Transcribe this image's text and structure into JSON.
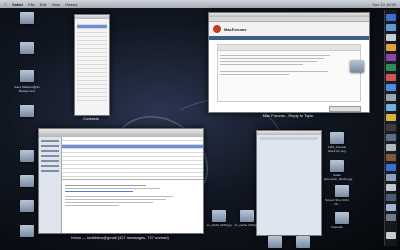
{
  "menubar": {
    "apple": "",
    "app": "Safari",
    "items": [
      "File",
      "Edit",
      "View",
      "History"
    ],
    "clock": "Sun 13 16:59"
  },
  "windows": {
    "contacts": {
      "caption": "Contacts"
    },
    "forum": {
      "caption": "Mac Forums - Reply to Topic",
      "site": "MacForums"
    },
    "mail": {
      "caption": "Inbox — lookitsbo@gmail (427 messages, 727 unread)"
    },
    "itunes": {
      "caption": ""
    }
  },
  "desktop_icons": [
    {
      "label": "Gaze Matched@2x Background"
    },
    {
      "label": ""
    },
    {
      "label": ""
    },
    {
      "label": ""
    },
    {
      "label": ""
    },
    {
      "label": ""
    },
    {
      "label": ""
    },
    {
      "label": ""
    }
  ],
  "right_icons": [
    {
      "label": "1181_Female Mock Up.png"
    },
    {
      "label": "Safari Extension_Mocks.jpg"
    },
    {
      "label": "Screen Shot 2011 10..."
    },
    {
      "label": "Fastrack"
    },
    {
      "label": ""
    }
  ],
  "bottom_icons": [
    {
      "label": "sc_cache 1109.jpg"
    },
    {
      "label": "sc_cache 1109.jpg"
    },
    {
      "label": "sc_cache 1109.jpg"
    },
    {
      "label": "sc_cache 1109.jpg"
    }
  ],
  "colors": {
    "accent": "#3d6fcf",
    "desktop": "#0a0e14"
  }
}
